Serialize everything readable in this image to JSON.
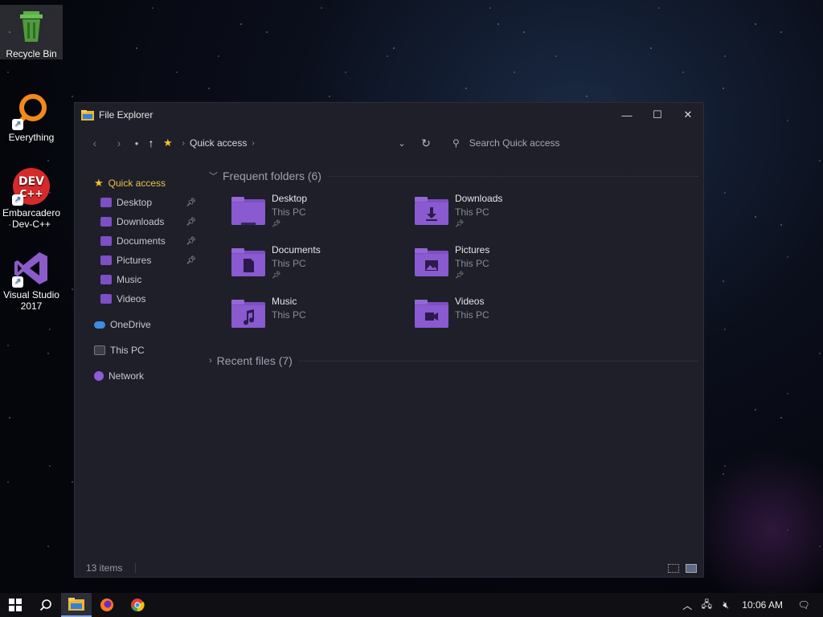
{
  "desktop": {
    "icons": [
      {
        "label": "Recycle Bin"
      },
      {
        "label": "Everything"
      },
      {
        "label": "Embarcadero Dev-C++"
      },
      {
        "label": "Visual Studio 2017"
      }
    ]
  },
  "window": {
    "title": "File Explorer",
    "breadcrumb": "Quick access",
    "search_placeholder": "Search Quick access",
    "sidebar": {
      "quick_access": "Quick access",
      "pinned": [
        {
          "label": "Desktop",
          "pinned": true
        },
        {
          "label": "Downloads",
          "pinned": true
        },
        {
          "label": "Documents",
          "pinned": true
        },
        {
          "label": "Pictures",
          "pinned": true
        },
        {
          "label": "Music",
          "pinned": false
        },
        {
          "label": "Videos",
          "pinned": false
        }
      ],
      "onedrive": "OneDrive",
      "this_pc": "This PC",
      "network": "Network"
    },
    "frequent": {
      "header": "Frequent folders (6)",
      "folders": [
        {
          "name": "Desktop",
          "location": "This PC",
          "pinned": true,
          "icon": "desktop-folder"
        },
        {
          "name": "Downloads",
          "location": "This PC",
          "pinned": true,
          "icon": "downloads-folder"
        },
        {
          "name": "Documents",
          "location": "This PC",
          "pinned": true,
          "icon": "documents-folder"
        },
        {
          "name": "Pictures",
          "location": "This PC",
          "pinned": true,
          "icon": "pictures-folder"
        },
        {
          "name": "Music",
          "location": "This PC",
          "pinned": false,
          "icon": "music-folder"
        },
        {
          "name": "Videos",
          "location": "This PC",
          "pinned": false,
          "icon": "videos-folder"
        }
      ]
    },
    "recent": {
      "header": "Recent files (7)"
    },
    "status": {
      "items": "13 items"
    }
  },
  "taskbar": {
    "clock": "10:06 AM"
  },
  "colors": {
    "folder": "#7d4fc4",
    "accent_star": "#f4c430",
    "window_bg": "#1e1f29"
  }
}
